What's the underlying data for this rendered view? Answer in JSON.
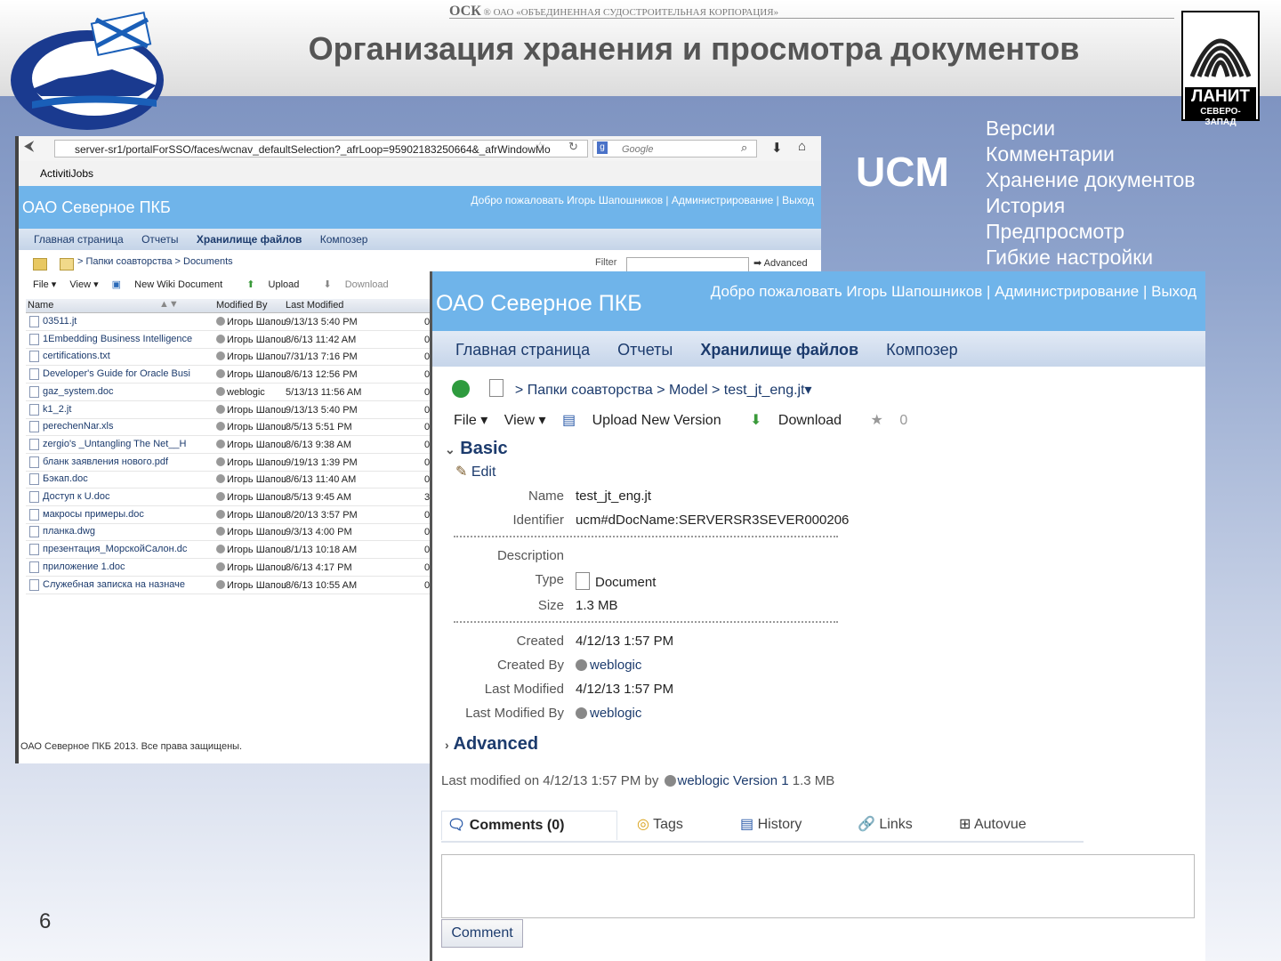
{
  "slide": {
    "corp_text": "ОАО «ОБЪЕДИНЕННАЯ СУДОСТРОИТЕЛЬНАЯ КОРПОРАЦИЯ»",
    "title": "Организация хранения и просмотра документов",
    "lanit_name": "ЛАНИТ",
    "lanit_sub": "СЕВЕРО-ЗАПАД",
    "ucm": "UCM",
    "features": [
      "Версии",
      "Комментарии",
      "Хранение документов",
      "История",
      "Предпросмотр",
      "Гибкие настройки"
    ],
    "page_number": "6"
  },
  "window1": {
    "url": "server-sr1/portalForSSO/faces/wcnav_defaultSelection?_afrLoop=95902183250664&_afrWindowMo",
    "search_placeholder": "Google",
    "bookmark": "ActivitiJobs",
    "brand": "ОАО Северное ПКБ",
    "welcome": "Добро пожаловать Игорь Шапошников | Администрирование | Выход",
    "nav": [
      "Главная страница",
      "Отчеты",
      "Хранилище файлов",
      "Композер"
    ],
    "breadcrumb": "> Папки соавторства > Documents",
    "filter_label": "Filter",
    "advanced": "Advanced",
    "toolbar": {
      "file": "File ▾",
      "view": "View ▾",
      "new_wiki": "New Wiki Document",
      "upload": "Upload",
      "download": "Download"
    },
    "columns": [
      "Name",
      "Modified By",
      "Last Modified"
    ],
    "rows": [
      {
        "name": "03511.jt",
        "by": "Игорь Шапош",
        "date": "9/13/13 5:40 PM",
        "n": "0"
      },
      {
        "name": "1Embedding Business Intelligence",
        "by": "Игорь Шапош",
        "date": "8/6/13 11:42 AM",
        "n": "0"
      },
      {
        "name": "certifications.txt",
        "by": "Игорь Шапош",
        "date": "7/31/13 7:16 PM",
        "n": "0"
      },
      {
        "name": "Developer's Guide for Oracle Busi",
        "by": "Игорь Шапош",
        "date": "8/6/13 12:56 PM",
        "n": "0"
      },
      {
        "name": "gaz_system.doc",
        "by": "weblogic",
        "date": "5/13/13 11:56 AM",
        "n": "0"
      },
      {
        "name": "k1_2.jt",
        "by": "Игорь Шапош",
        "date": "9/13/13 5:40 PM",
        "n": "0"
      },
      {
        "name": "perechenNar.xls",
        "by": "Игорь Шапош",
        "date": "8/5/13 5:51 PM",
        "n": "0"
      },
      {
        "name": "zergio's _Untangling The Net__H",
        "by": "Игорь Шапош",
        "date": "8/6/13 9:38 AM",
        "n": "0"
      },
      {
        "name": "бланк заявления нового.pdf",
        "by": "Игорь Шапош",
        "date": "9/19/13 1:39 PM",
        "n": "0"
      },
      {
        "name": "Бэкап.doc",
        "by": "Игорь Шапош",
        "date": "8/6/13 11:40 AM",
        "n": "0"
      },
      {
        "name": "Доступ к U.doc",
        "by": "Игорь Шапош",
        "date": "8/5/13 9:45 AM",
        "n": "3"
      },
      {
        "name": "макросы примеры.doc",
        "by": "Игорь Шапош",
        "date": "8/20/13 3:57 PM",
        "n": "0"
      },
      {
        "name": "планка.dwg",
        "by": "Игорь Шапош",
        "date": "9/3/13 4:00 PM",
        "n": "0"
      },
      {
        "name": "презентация_МорскойСалон.dc",
        "by": "Игорь Шапош",
        "date": "8/1/13 10:18 AM",
        "n": "0"
      },
      {
        "name": "приложение 1.doc",
        "by": "Игорь Шапош",
        "date": "8/6/13 4:17 PM",
        "n": "0"
      },
      {
        "name": "Служебная записка на назначе",
        "by": "Игорь Шапош",
        "date": "8/6/13 10:55 AM",
        "n": "0"
      }
    ],
    "footer": "ОАО Северное ПКБ 2013. Все права защищены."
  },
  "window2": {
    "brand": "ОАО Северное ПКБ",
    "welcome": "Добро пожаловать Игорь Шапошников | Администрирование | Выход",
    "nav": [
      "Главная страница",
      "Отчеты",
      "Хранилище файлов",
      "Композер"
    ],
    "breadcrumb": "> Папки соавторства > Model > test_jt_eng.jt▾",
    "toolbar": {
      "file": "File ▾",
      "view": "View ▾",
      "upload": "Upload New Version",
      "download": "Download",
      "rating": "0"
    },
    "basic": "Basic",
    "edit": "Edit",
    "props": {
      "name_label": "Name",
      "name": "test_jt_eng.jt",
      "id_label": "Identifier",
      "id": "ucm#dDocName:SERVERSR3SEVER000206",
      "desc_label": "Description",
      "type_label": "Type",
      "type": "Document",
      "size_label": "Size",
      "size": "1.3 MB",
      "created_label": "Created",
      "created": "4/12/13 1:57 PM",
      "createdby_label": "Created By",
      "createdby": "weblogic",
      "lastmod_label": "Last Modified",
      "lastmod": "4/12/13 1:57 PM",
      "lastmodby_label": "Last Modified By",
      "lastmodby": "weblogic"
    },
    "advanced": "Advanced",
    "lastmod_line": "Last modified on 4/12/13 1:57 PM by",
    "lastmod_user": "weblogic",
    "version": "Version 1",
    "version_size": "1.3 MB",
    "tabs": [
      "Comments (0)",
      "Tags",
      "History",
      "Links",
      "Autovue"
    ],
    "comment_button": "Comment"
  },
  "colors": {
    "banner": "#6fb4ea",
    "link": "#1c3b6d",
    "slide_bg": "#7e93c0"
  }
}
